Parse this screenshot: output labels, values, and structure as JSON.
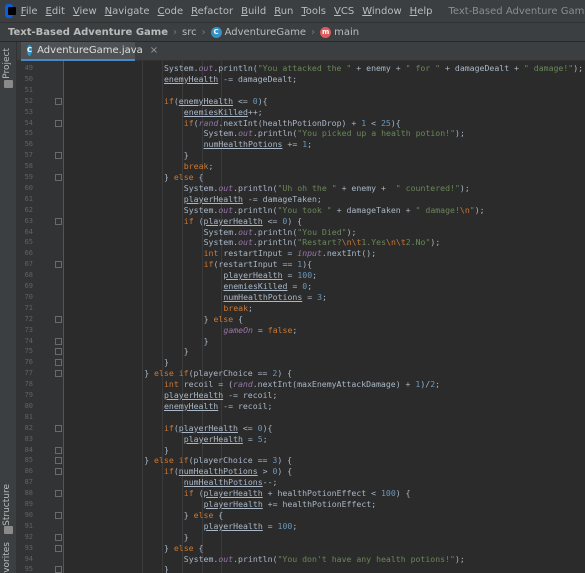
{
  "menubar": {
    "items": [
      {
        "label": "File",
        "u": "F",
        "rest": "ile"
      },
      {
        "label": "Edit",
        "u": "E",
        "rest": "dit"
      },
      {
        "label": "View",
        "u": "V",
        "rest": "iew"
      },
      {
        "label": "Navigate",
        "u": "N",
        "rest": "avigate"
      },
      {
        "label": "Code",
        "u": "C",
        "rest": "ode"
      },
      {
        "label": "Refactor",
        "u": "R",
        "rest": "efactor"
      },
      {
        "label": "Build",
        "u": "B",
        "rest": "uild"
      },
      {
        "label": "Run",
        "u": "R",
        "rest": "un"
      },
      {
        "label": "Tools",
        "u": "T",
        "rest": "ools"
      },
      {
        "label": "VCS",
        "u": "V",
        "rest": "CS"
      },
      {
        "label": "Window",
        "u": "W",
        "rest": "indow"
      },
      {
        "label": "Help",
        "u": "H",
        "rest": "elp"
      }
    ],
    "window_title": "Text-Based Adventure Game - AdventureGame.ja"
  },
  "navbar": {
    "project": "Text-Based Adventure Game",
    "folder": "src",
    "class_name": "AdventureGame",
    "method": "main"
  },
  "tab": {
    "label": "AdventureGame.java",
    "close": "×"
  },
  "sidebar": {
    "project_label": "Project",
    "structure_label": "Structure",
    "favorites_label": "Favorites"
  },
  "colors": {
    "keyword": "#cc7832",
    "string": "#6a8759",
    "number": "#6897bb",
    "field": "#9876aa",
    "text": "#a9b7c6",
    "background": "#2b2b2b"
  },
  "editor": {
    "lines": [
      {
        "n": "49",
        "indent": 5,
        "fold": false,
        "tokens": [
          [
            "System.",
            ""
          ],
          [
            "out",
            "fld"
          ],
          [
            ".println(",
            ""
          ],
          [
            "\"You attacked the \"",
            "str"
          ],
          [
            " + enemy + ",
            ""
          ],
          [
            "\" for \"",
            "str"
          ],
          [
            " + damageDealt + ",
            ""
          ],
          [
            "\" damage!\"",
            "str"
          ],
          [
            ");",
            ""
          ]
        ]
      },
      {
        "n": "50",
        "indent": 5,
        "fold": false,
        "tokens": [
          [
            "enemyHealth",
            "uline"
          ],
          [
            " -= damageDealt;",
            ""
          ]
        ]
      },
      {
        "n": "51",
        "indent": 0,
        "fold": false,
        "tokens": []
      },
      {
        "n": "52",
        "indent": 5,
        "fold": true,
        "tokens": [
          [
            "if",
            "kw"
          ],
          [
            "(",
            ""
          ],
          [
            "enemyHealth",
            "uline"
          ],
          [
            " <= ",
            ""
          ],
          [
            "0",
            "num"
          ],
          [
            "){",
            ""
          ]
        ]
      },
      {
        "n": "53",
        "indent": 6,
        "fold": false,
        "tokens": [
          [
            "enemiesKilled",
            "uline"
          ],
          [
            "++;",
            ""
          ]
        ]
      },
      {
        "n": "54",
        "indent": 6,
        "fold": true,
        "tokens": [
          [
            "if",
            "kw"
          ],
          [
            "(",
            ""
          ],
          [
            "rand",
            "fld"
          ],
          [
            ".nextInt(healthPotionDrop) + ",
            ""
          ],
          [
            "1",
            "num"
          ],
          [
            " < ",
            ""
          ],
          [
            "25",
            "num"
          ],
          [
            "){",
            ""
          ]
        ]
      },
      {
        "n": "55",
        "indent": 7,
        "fold": false,
        "tokens": [
          [
            "System.",
            ""
          ],
          [
            "out",
            "fld"
          ],
          [
            ".println(",
            ""
          ],
          [
            "\"You picked up a health potion!\"",
            "str"
          ],
          [
            ");",
            ""
          ]
        ]
      },
      {
        "n": "56",
        "indent": 7,
        "fold": false,
        "tokens": [
          [
            "numHealthPotions",
            "uline"
          ],
          [
            " += ",
            ""
          ],
          [
            "1",
            "num"
          ],
          [
            ";",
            ""
          ]
        ]
      },
      {
        "n": "57",
        "indent": 6,
        "fold": true,
        "tokens": [
          [
            "}",
            ""
          ]
        ]
      },
      {
        "n": "58",
        "indent": 6,
        "fold": false,
        "tokens": [
          [
            "break",
            "kw"
          ],
          [
            ";",
            ""
          ]
        ]
      },
      {
        "n": "59",
        "indent": 5,
        "fold": true,
        "tokens": [
          [
            "} ",
            ""
          ],
          [
            "else",
            "kw"
          ],
          [
            " {",
            ""
          ]
        ]
      },
      {
        "n": "60",
        "indent": 6,
        "fold": false,
        "tokens": [
          [
            "System.",
            ""
          ],
          [
            "out",
            "fld"
          ],
          [
            ".println(",
            ""
          ],
          [
            "\"Uh oh the \"",
            "str"
          ],
          [
            " + enemy +  ",
            ""
          ],
          [
            "\" countered!\"",
            "str"
          ],
          [
            ");",
            ""
          ]
        ]
      },
      {
        "n": "61",
        "indent": 6,
        "fold": false,
        "tokens": [
          [
            "playerHealth",
            "uline"
          ],
          [
            " -= damageTaken;",
            ""
          ]
        ]
      },
      {
        "n": "62",
        "indent": 6,
        "fold": false,
        "tokens": [
          [
            "System.",
            ""
          ],
          [
            "out",
            "fld"
          ],
          [
            ".println(",
            ""
          ],
          [
            "\"You took \"",
            "str"
          ],
          [
            " + damageTaken + ",
            ""
          ],
          [
            "\" damage!",
            "str"
          ],
          [
            "\\n",
            "esc"
          ],
          [
            "\"",
            "str"
          ],
          [
            ");",
            ""
          ]
        ]
      },
      {
        "n": "63",
        "indent": 6,
        "fold": true,
        "tokens": [
          [
            "if",
            "kw"
          ],
          [
            " (",
            ""
          ],
          [
            "playerHealth",
            "uline"
          ],
          [
            " <= ",
            ""
          ],
          [
            "0",
            "num"
          ],
          [
            ") {",
            ""
          ]
        ]
      },
      {
        "n": "64",
        "indent": 7,
        "fold": false,
        "tokens": [
          [
            "System.",
            ""
          ],
          [
            "out",
            "fld"
          ],
          [
            ".println(",
            ""
          ],
          [
            "\"You Died\"",
            "str"
          ],
          [
            ");",
            ""
          ]
        ]
      },
      {
        "n": "65",
        "indent": 7,
        "fold": false,
        "tokens": [
          [
            "System.",
            ""
          ],
          [
            "out",
            "fld"
          ],
          [
            ".println(",
            ""
          ],
          [
            "\"Restart?",
            "str"
          ],
          [
            "\\n\\t",
            "esc"
          ],
          [
            "1.Yes",
            "str"
          ],
          [
            "\\n\\t",
            "esc"
          ],
          [
            "2.No\"",
            "str"
          ],
          [
            ");",
            ""
          ]
        ]
      },
      {
        "n": "66",
        "indent": 7,
        "fold": false,
        "tokens": [
          [
            "int",
            "kw"
          ],
          [
            " restartInput = ",
            ""
          ],
          [
            "input",
            "fld"
          ],
          [
            ".nextInt();",
            ""
          ]
        ]
      },
      {
        "n": "67",
        "indent": 7,
        "fold": true,
        "tokens": [
          [
            "if",
            "kw"
          ],
          [
            "(restartInput == ",
            ""
          ],
          [
            "1",
            "num"
          ],
          [
            "){",
            ""
          ]
        ]
      },
      {
        "n": "68",
        "indent": 8,
        "fold": false,
        "tokens": [
          [
            "playerHealth",
            "uline"
          ],
          [
            " = ",
            ""
          ],
          [
            "100",
            "num"
          ],
          [
            ";",
            ""
          ]
        ]
      },
      {
        "n": "69",
        "indent": 8,
        "fold": false,
        "tokens": [
          [
            "enemiesKilled",
            "uline"
          ],
          [
            " = ",
            ""
          ],
          [
            "0",
            "num"
          ],
          [
            ";",
            ""
          ]
        ]
      },
      {
        "n": "70",
        "indent": 8,
        "fold": false,
        "tokens": [
          [
            "numHealthPotions",
            "uline"
          ],
          [
            " = ",
            ""
          ],
          [
            "3",
            "num"
          ],
          [
            ";",
            ""
          ]
        ]
      },
      {
        "n": "71",
        "indent": 8,
        "fold": false,
        "tokens": [
          [
            "break",
            "kw"
          ],
          [
            ";",
            ""
          ]
        ]
      },
      {
        "n": "72",
        "indent": 7,
        "fold": true,
        "tokens": [
          [
            "} ",
            ""
          ],
          [
            "else",
            "kw"
          ],
          [
            " {",
            ""
          ]
        ]
      },
      {
        "n": "73",
        "indent": 8,
        "fold": false,
        "tokens": [
          [
            "gameOn",
            "fld"
          ],
          [
            " = ",
            ""
          ],
          [
            "false",
            "kw"
          ],
          [
            ";",
            ""
          ]
        ]
      },
      {
        "n": "74",
        "indent": 7,
        "fold": true,
        "tokens": [
          [
            "}",
            ""
          ]
        ]
      },
      {
        "n": "75",
        "indent": 6,
        "fold": true,
        "tokens": [
          [
            "}",
            ""
          ]
        ]
      },
      {
        "n": "76",
        "indent": 5,
        "fold": true,
        "tokens": [
          [
            "}",
            ""
          ]
        ]
      },
      {
        "n": "77",
        "indent": 4,
        "fold": true,
        "tokens": [
          [
            "} ",
            ""
          ],
          [
            "else if",
            "kw"
          ],
          [
            "(playerChoice == ",
            ""
          ],
          [
            "2",
            "num"
          ],
          [
            ") {",
            ""
          ]
        ]
      },
      {
        "n": "78",
        "indent": 5,
        "fold": false,
        "tokens": [
          [
            "int",
            "kw"
          ],
          [
            " recoil = (",
            ""
          ],
          [
            "rand",
            "fld"
          ],
          [
            ".nextInt(maxEnemyAttackDamage) + ",
            ""
          ],
          [
            "1",
            "num"
          ],
          [
            ")/",
            ""
          ],
          [
            "2",
            "num"
          ],
          [
            ";",
            ""
          ]
        ]
      },
      {
        "n": "79",
        "indent": 5,
        "fold": false,
        "tokens": [
          [
            "playerHealth",
            "uline"
          ],
          [
            " -= recoil;",
            ""
          ]
        ]
      },
      {
        "n": "80",
        "indent": 5,
        "fold": false,
        "tokens": [
          [
            "enemyHealth",
            "uline"
          ],
          [
            " -= recoil;",
            ""
          ]
        ]
      },
      {
        "n": "81",
        "indent": 0,
        "fold": false,
        "tokens": []
      },
      {
        "n": "82",
        "indent": 5,
        "fold": true,
        "tokens": [
          [
            "if",
            "kw"
          ],
          [
            "(",
            ""
          ],
          [
            "playerHealth",
            "uline"
          ],
          [
            " <= ",
            ""
          ],
          [
            "0",
            "num"
          ],
          [
            "){",
            ""
          ]
        ]
      },
      {
        "n": "83",
        "indent": 6,
        "fold": false,
        "tokens": [
          [
            "playerHealth",
            "uline"
          ],
          [
            " = ",
            ""
          ],
          [
            "5",
            "num"
          ],
          [
            ";",
            ""
          ]
        ]
      },
      {
        "n": "84",
        "indent": 5,
        "fold": true,
        "tokens": [
          [
            "}",
            ""
          ]
        ]
      },
      {
        "n": "85",
        "indent": 4,
        "fold": true,
        "tokens": [
          [
            "} ",
            ""
          ],
          [
            "else if",
            "kw"
          ],
          [
            "(playerChoice == ",
            ""
          ],
          [
            "3",
            "num"
          ],
          [
            ") {",
            ""
          ]
        ]
      },
      {
        "n": "86",
        "indent": 5,
        "fold": true,
        "tokens": [
          [
            "if",
            "kw"
          ],
          [
            "(",
            ""
          ],
          [
            "numHealthPotions",
            "uline"
          ],
          [
            " > ",
            ""
          ],
          [
            "0",
            "num"
          ],
          [
            ") {",
            ""
          ]
        ]
      },
      {
        "n": "87",
        "indent": 6,
        "fold": false,
        "tokens": [
          [
            "numHealthPotions",
            "uline"
          ],
          [
            "--;",
            ""
          ]
        ]
      },
      {
        "n": "88",
        "indent": 6,
        "fold": true,
        "tokens": [
          [
            "if",
            "kw"
          ],
          [
            " (",
            ""
          ],
          [
            "playerHealth",
            "uline"
          ],
          [
            " + healthPotionEffect < ",
            ""
          ],
          [
            "100",
            "num"
          ],
          [
            ") {",
            ""
          ]
        ]
      },
      {
        "n": "89",
        "indent": 7,
        "fold": false,
        "tokens": [
          [
            "playerHealth",
            "uline"
          ],
          [
            " += healthPotionEffect;",
            ""
          ]
        ]
      },
      {
        "n": "90",
        "indent": 6,
        "fold": true,
        "tokens": [
          [
            "} ",
            ""
          ],
          [
            "else",
            "kw"
          ],
          [
            " {",
            ""
          ]
        ]
      },
      {
        "n": "91",
        "indent": 7,
        "fold": false,
        "tokens": [
          [
            "playerHealth",
            "uline"
          ],
          [
            " = ",
            ""
          ],
          [
            "100",
            "num"
          ],
          [
            ";",
            ""
          ]
        ]
      },
      {
        "n": "92",
        "indent": 6,
        "fold": true,
        "tokens": [
          [
            "}",
            ""
          ]
        ]
      },
      {
        "n": "93",
        "indent": 5,
        "fold": true,
        "tokens": [
          [
            "} ",
            ""
          ],
          [
            "else",
            "kw"
          ],
          [
            " {",
            ""
          ]
        ]
      },
      {
        "n": "94",
        "indent": 6,
        "fold": false,
        "tokens": [
          [
            "System.",
            ""
          ],
          [
            "out",
            "fld"
          ],
          [
            ".println(",
            ""
          ],
          [
            "\"You don't have any health potions!\"",
            "str"
          ],
          [
            ");",
            ""
          ]
        ]
      },
      {
        "n": "95",
        "indent": 5,
        "fold": true,
        "tokens": [
          [
            "}",
            ""
          ]
        ]
      }
    ]
  }
}
